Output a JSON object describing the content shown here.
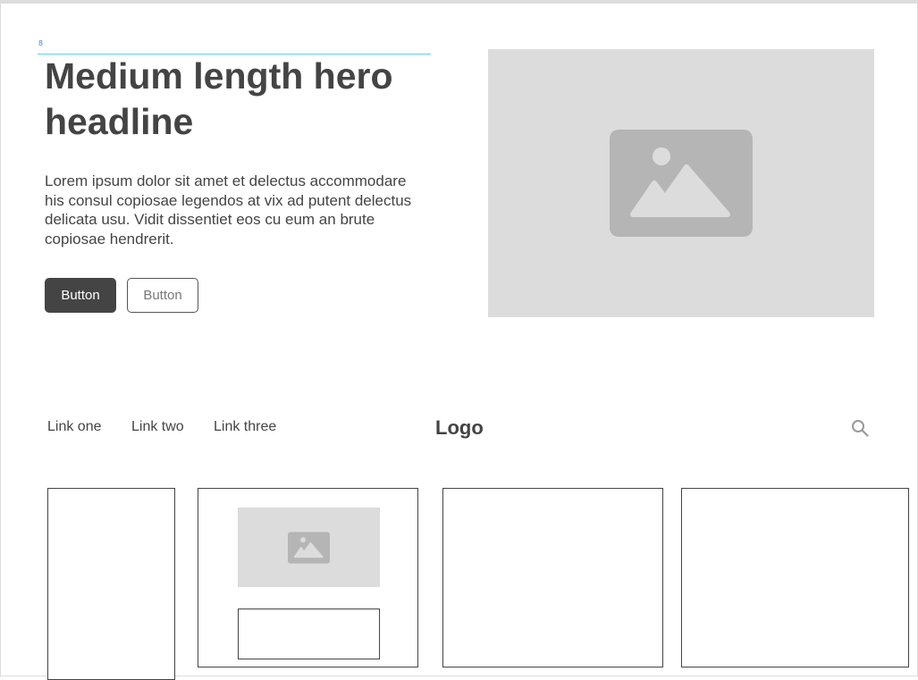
{
  "annotation": {
    "guide_value": "8"
  },
  "hero": {
    "title": "Medium length hero headline",
    "body": "Lorem ipsum dolor sit amet et delectus accommodare his consul copiosae legendos at vix ad putent delectus delicata usu. Vidit dissentiet eos cu eum an brute copiosae hendrerit.",
    "primary_button": "Button",
    "secondary_button": "Button",
    "image_icon": "image-placeholder-icon"
  },
  "nav": {
    "links": [
      "Link one",
      "Link two",
      "Link three"
    ],
    "logo": "Logo",
    "search_icon": "search-icon"
  },
  "cards": {
    "count": 4,
    "image_icon": "image-placeholder-icon"
  },
  "colors": {
    "text": "#444444",
    "placeholder_bg": "#dcdcdc",
    "placeholder_icon": "#b5b5b5",
    "guide": "#5fd0e6"
  }
}
